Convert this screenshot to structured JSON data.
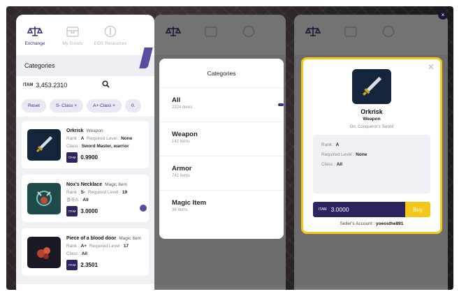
{
  "tabs": [
    {
      "label": "Exchange",
      "icon": "scale-icon"
    },
    {
      "label": "My Goods",
      "icon": "chest-icon"
    },
    {
      "label": "EOS Resources",
      "icon": "coin-icon"
    }
  ],
  "categories_label": "Categories",
  "balance": {
    "currency": "ITAM",
    "value": "3,453.2310"
  },
  "filter_chips": [
    "Reset",
    "S- Class ×",
    "A+ Class ×",
    "0."
  ],
  "items": [
    {
      "name": "Orkrisk",
      "type": "Weapon",
      "rank_label": "Rank :",
      "rank": "A",
      "level_label": "Required Level :",
      "level": "None",
      "class_label": "Class :",
      "class": "Sword Master, warrior",
      "price_currency": "ITAM",
      "price": "0.9900"
    },
    {
      "name": "Nox's Necklace",
      "type": "Magic Item",
      "rank_label": "Rank :",
      "rank": "S-",
      "level_label": "Required Level :",
      "level": "19",
      "class_label": "클래스 :",
      "class": "All",
      "price_currency": "ITAM",
      "price": "3.0000"
    },
    {
      "name": "Piece of a blood door",
      "type": "Magic Item",
      "rank_label": "Rank :",
      "rank": "A+",
      "level_label": "Required Level :",
      "level": "17",
      "class_label": "Class :",
      "class": "All",
      "price_currency": "ITAM",
      "price": "2.3501"
    }
  ],
  "category_popup": {
    "title": "Categories",
    "options": [
      {
        "name": "All",
        "count": "2324 items"
      },
      {
        "name": "Weapon",
        "count": "142 items"
      },
      {
        "name": "Armor",
        "count": "742 items"
      },
      {
        "name": "Magic Item",
        "count": "36 items"
      }
    ]
  },
  "detail": {
    "name": "Orkrisk",
    "type": "Weapon",
    "origin": "On, Conqueror's Sword",
    "rank_label": "Rank :",
    "rank": "A",
    "level_label": "Required Level :",
    "level": "None",
    "class_label": "Class :",
    "class": "All",
    "price_currency": "ITAM",
    "price": "3.0000",
    "buy_label": "Buy",
    "seller_label": "Seller's Account :",
    "seller": "yoeosthe891"
  },
  "close_symbol": "×"
}
